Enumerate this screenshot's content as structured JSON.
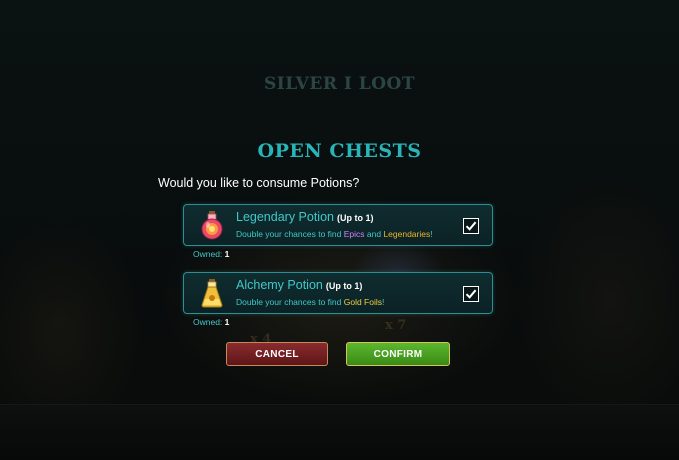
{
  "background": {
    "loot_title": "SILVER I LOOT",
    "multipliers": [
      "x 4",
      "x 7"
    ]
  },
  "dialog": {
    "title": "OPEN CHESTS",
    "question": "Would you like to consume Potions?",
    "potions": [
      {
        "icon": "legendary-potion-icon",
        "name": "Legendary Potion",
        "limit": "(Up to 1)",
        "desc_prefix": "Double your chances to find ",
        "desc_highlight_1": "Epics",
        "desc_middle": " and ",
        "desc_highlight_2": "Legendaries",
        "desc_suffix": "!",
        "checked": true,
        "owned_label": "Owned:",
        "owned_value": "1"
      },
      {
        "icon": "alchemy-potion-icon",
        "name": "Alchemy Potion",
        "limit": "(Up to 1)",
        "desc_prefix": "Double your chances to find ",
        "desc_highlight_1": "Gold Foils",
        "desc_suffix": "!",
        "checked": true,
        "owned_label": "Owned:",
        "owned_value": "1"
      }
    ],
    "cancel_label": "CANCEL",
    "confirm_label": "CONFIRM"
  },
  "colors": {
    "title_teal": "#29b5b8",
    "panel_border": "#2c8f94",
    "epic": "#d77dff",
    "legendary": "#f0b429",
    "gold_foil": "#f0d040",
    "cancel_red": "#7a2326",
    "confirm_green": "#4ea323"
  }
}
